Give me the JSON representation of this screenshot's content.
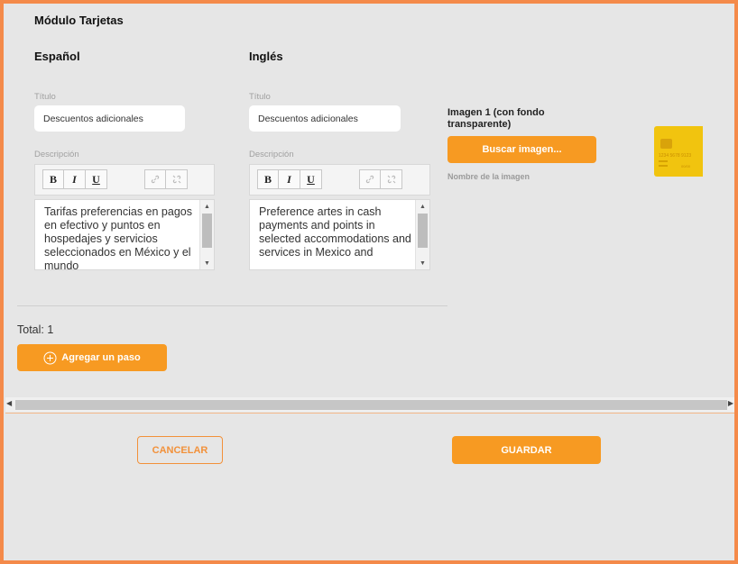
{
  "module": {
    "title": "Módulo Tarjetas"
  },
  "spanish": {
    "heading": "Español",
    "title_label": "Título",
    "title_value": "Descuentos adicionales",
    "desc_label": "Descripción",
    "desc_text": "Tarifas preferencias en pagos en efectivo y puntos en hospedajes y servicios seleccionados en México y el mundo"
  },
  "english": {
    "heading": "Inglés",
    "title_label": "Título",
    "title_value": "Descuentos adicionales",
    "desc_label": "Descripción",
    "desc_text": "Preference artes in cash payments and points in selected accommodations and services in Mexico and"
  },
  "toolbar": {
    "bold": "B",
    "italic": "I",
    "underline": "U"
  },
  "image": {
    "label": "Imagen 1 (con fondo transparente)",
    "button": "Buscar imagen...",
    "name_label": "Nombre de la imagen",
    "card_number": "1234 5678 9123",
    "card_date": "00/00"
  },
  "footer": {
    "total": "Total: 1",
    "add_step": "Agregar un paso",
    "cancel": "CANCELAR",
    "save": "GUARDAR"
  },
  "colors": {
    "accent": "#f79a22",
    "frame": "#f48a4a",
    "card": "#f1c40f"
  }
}
